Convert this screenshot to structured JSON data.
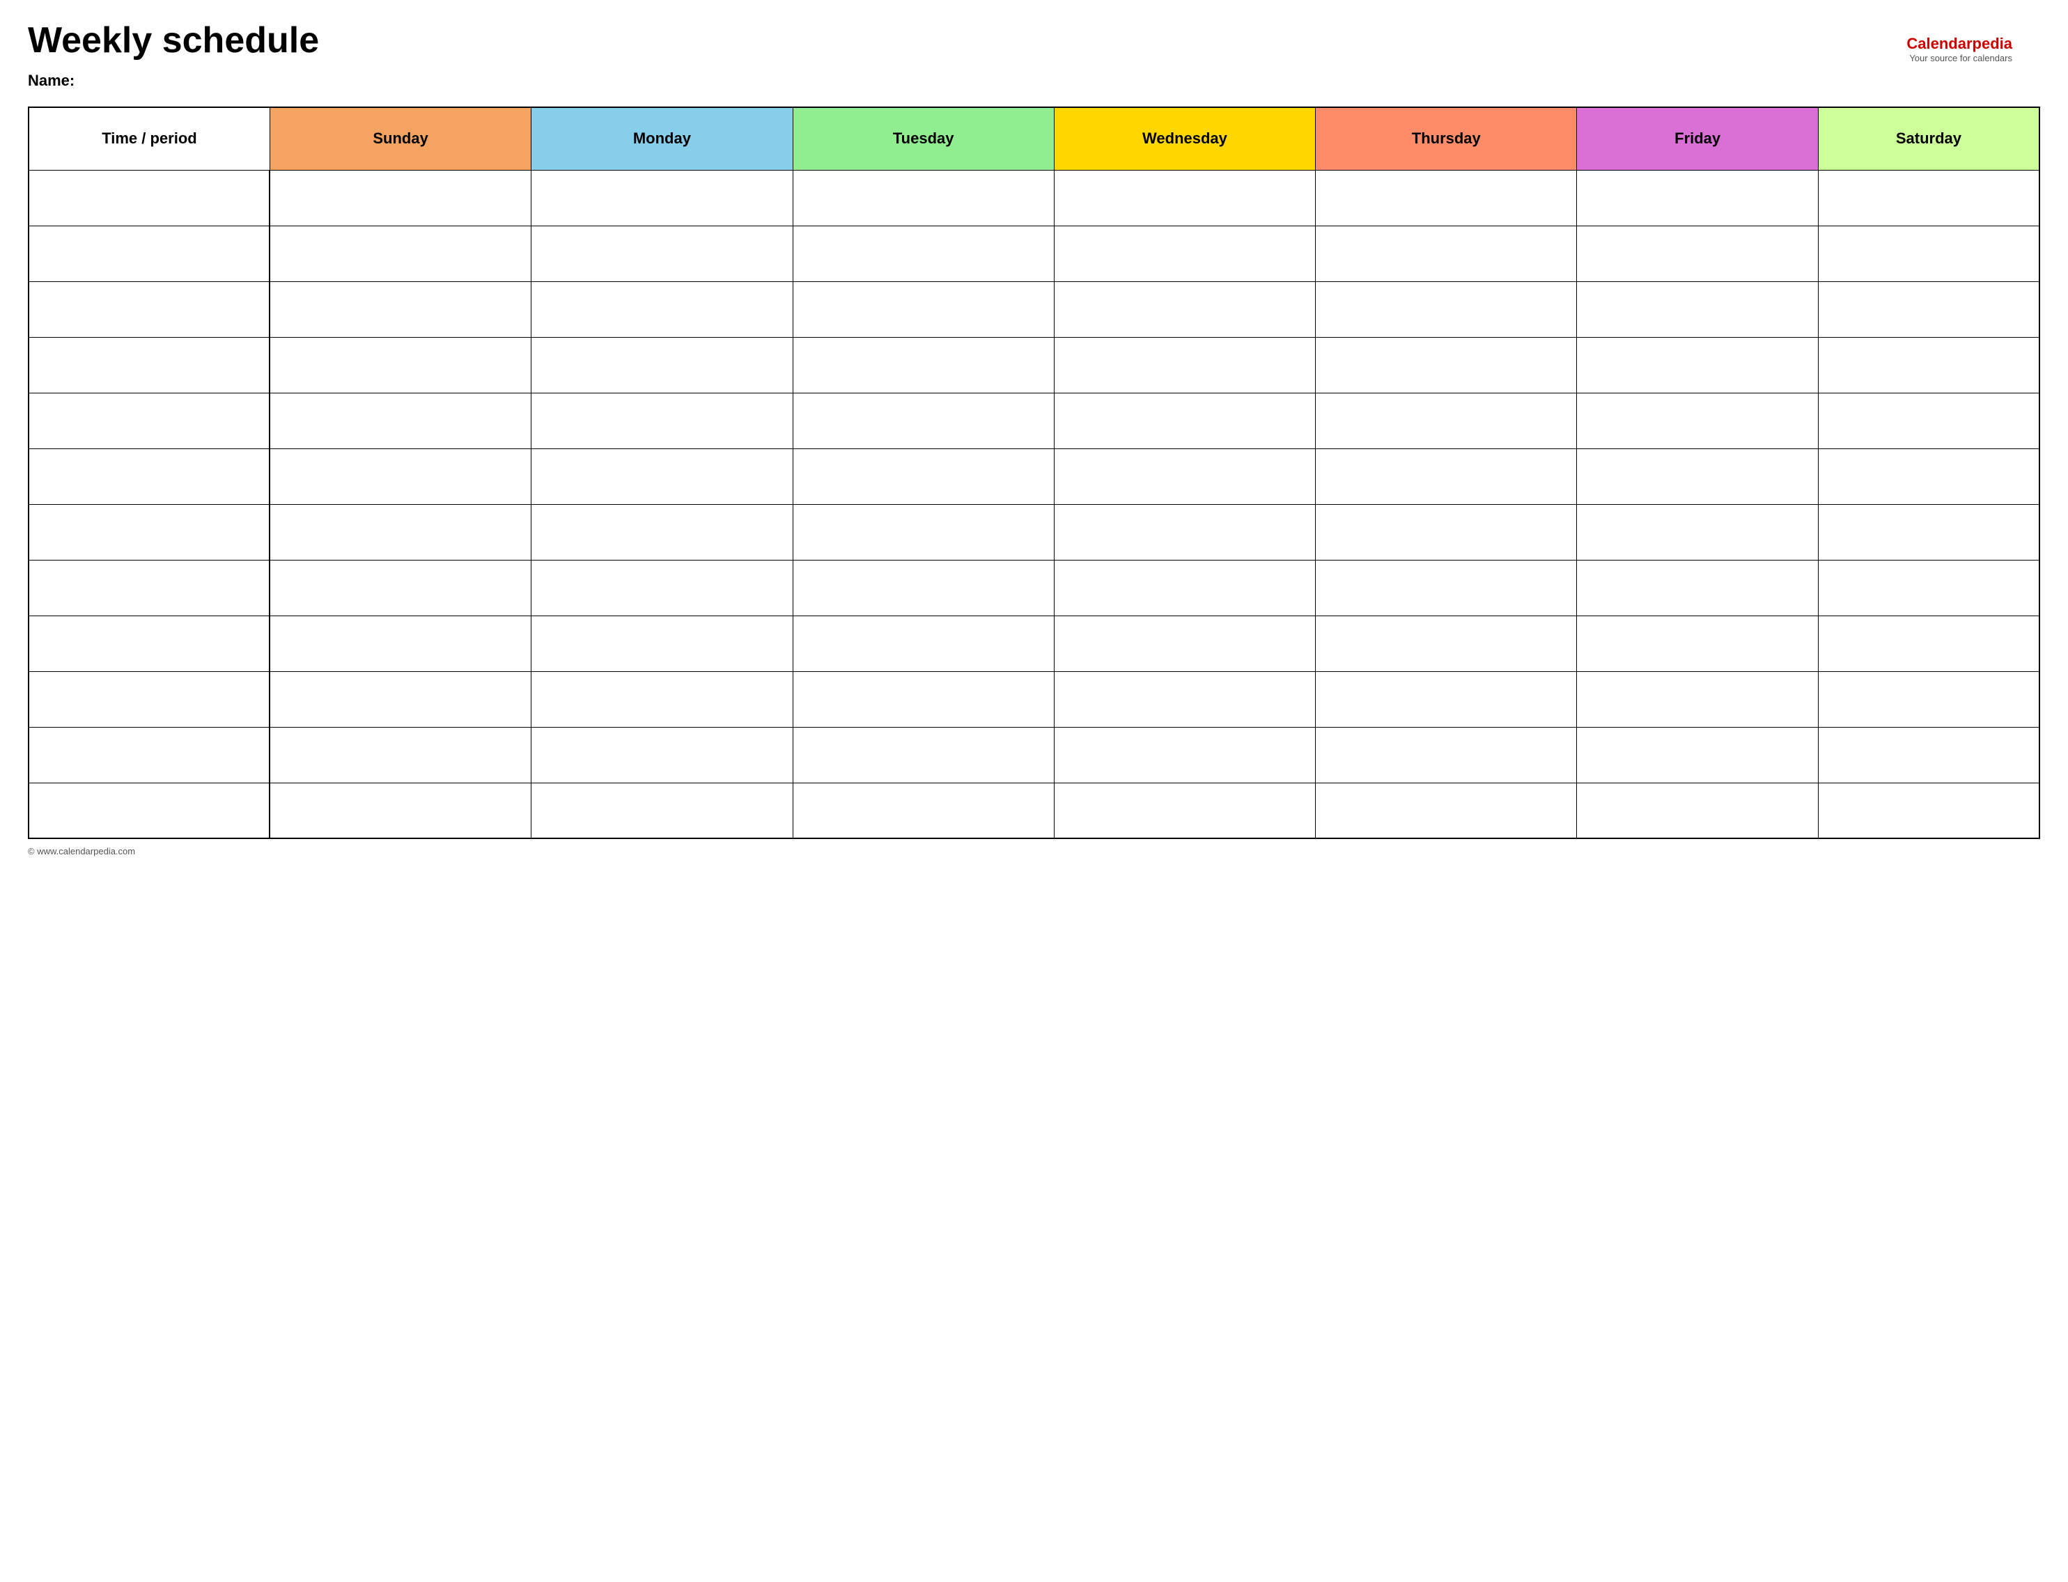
{
  "page": {
    "title": "Weekly schedule",
    "name_label": "Name:",
    "footer_text": "© www.calendarpedia.com"
  },
  "branding": {
    "logo_part1": "Calendar",
    "logo_part2": "pedia",
    "tagline": "Your source for calendars"
  },
  "table": {
    "headers": [
      {
        "id": "time",
        "label": "Time / period",
        "class": "th-time"
      },
      {
        "id": "sunday",
        "label": "Sunday",
        "class": "th-sunday"
      },
      {
        "id": "monday",
        "label": "Monday",
        "class": "th-monday"
      },
      {
        "id": "tuesday",
        "label": "Tuesday",
        "class": "th-tuesday"
      },
      {
        "id": "wednesday",
        "label": "Wednesday",
        "class": "th-wednesday"
      },
      {
        "id": "thursday",
        "label": "Thursday",
        "class": "th-thursday"
      },
      {
        "id": "friday",
        "label": "Friday",
        "class": "th-friday"
      },
      {
        "id": "saturday",
        "label": "Saturday",
        "class": "th-saturday"
      }
    ],
    "row_count": 12
  }
}
